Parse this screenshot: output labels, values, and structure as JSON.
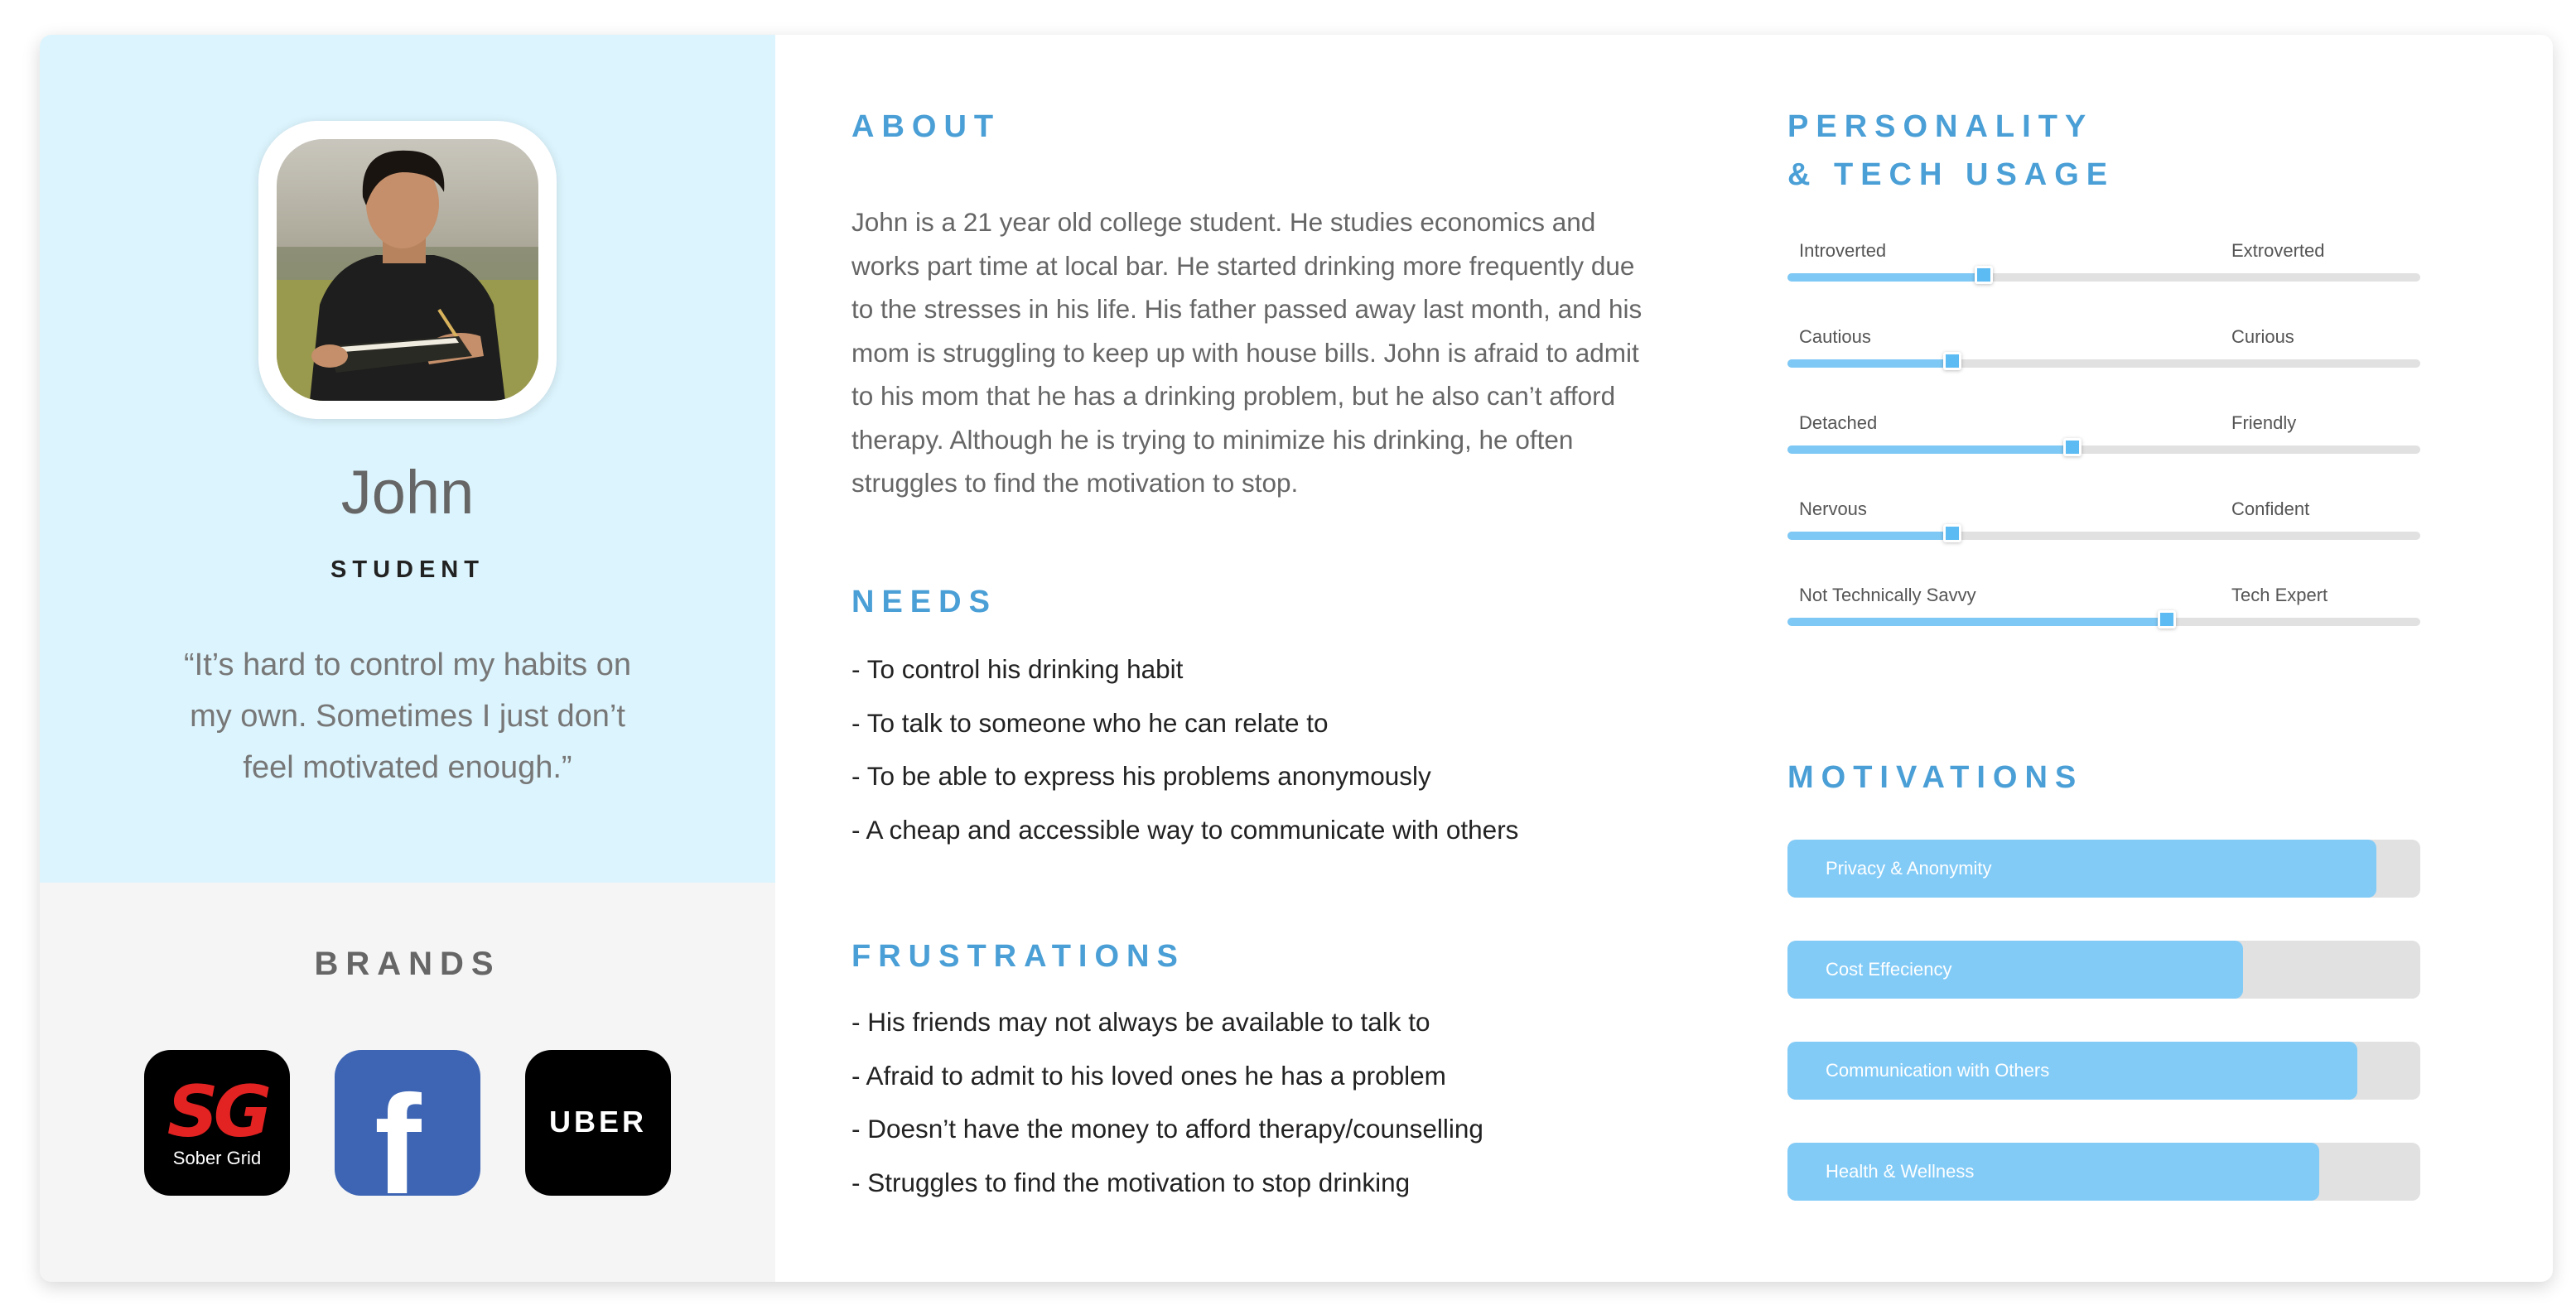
{
  "persona": {
    "name": "John",
    "role": "STUDENT",
    "quote": "“It’s hard to control my habits on my own. Sometimes I just don’t feel motivated enough.”"
  },
  "brands": {
    "title": "BRANDS",
    "items": [
      {
        "name": "Sober Grid",
        "mark": "SG",
        "icon": "sober-grid-logo",
        "color": "#e32222"
      },
      {
        "name": "Facebook",
        "mark": "f",
        "icon": "facebook-logo",
        "color": "#3d65b4"
      },
      {
        "name": "Uber",
        "mark": "UBER",
        "icon": "uber-logo",
        "color": "#000000"
      }
    ]
  },
  "about": {
    "title": "ABOUT",
    "text": "John is a 21 year old college student. He studies economics and works part time at local bar. He started drinking more frequently due to the stresses in his life. His father passed away last month, and his mom is struggling to keep up with house bills. John is afraid to admit to his mom that he has a drinking problem, but he also can’t afford therapy. Although he is trying to minimize his drinking, he often struggles to find the motivation to stop."
  },
  "needs": {
    "title": "NEEDS",
    "items": [
      "To control his drinking habit",
      "To talk to someone who he can relate to",
      "To be able to express his problems anonymously",
      "A cheap and accessible way to communicate with others"
    ]
  },
  "frustrations": {
    "title": "FRUSTRATIONS",
    "items": [
      "His friends may not always be available to talk to",
      "Afraid to admit to his loved ones he has a problem",
      "Doesn’t have the money to afford therapy/counselling",
      "Struggles to find the motivation to stop drinking"
    ]
  },
  "personality": {
    "title_line1": "PERSONALITY",
    "title_line2": "& TECH USAGE",
    "traits": [
      {
        "left": "Introverted",
        "right": "Extroverted",
        "value": 0.31
      },
      {
        "left": "Cautious",
        "right": "Curious",
        "value": 0.26
      },
      {
        "left": "Detached",
        "right": "Friendly",
        "value": 0.45
      },
      {
        "left": "Nervous",
        "right": "Confident",
        "value": 0.26
      },
      {
        "left": "Not Technically Savvy",
        "right": "Tech Expert",
        "value": 0.6
      }
    ]
  },
  "motivations": {
    "title": "MOTIVATIONS",
    "items": [
      {
        "label": "Privacy & Anonymity",
        "value": 0.93
      },
      {
        "label": "Cost Effeciency",
        "value": 0.72
      },
      {
        "label": "Communication with Others",
        "value": 0.9
      },
      {
        "label": "Health & Wellness",
        "value": 0.84
      }
    ]
  },
  "colors": {
    "accent": "#4a9fd6",
    "profile_bg": "#dcf4fd",
    "brands_bg": "#f5f5f5",
    "bar_fill": "#82cbf7",
    "track": "#e1e1e1"
  }
}
